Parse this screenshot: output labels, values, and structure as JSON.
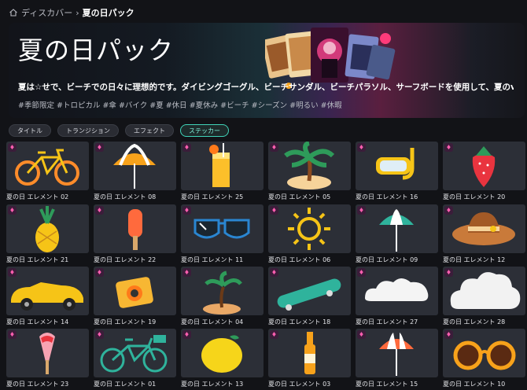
{
  "breadcrumb": {
    "home_label": "ディスカバー",
    "separator": "›",
    "current": "夏の日パック"
  },
  "hero": {
    "title": "夏の日パック",
    "description": "夏は☆せで、ビーチでの日々に理想的です。ダイビングゴーグル、ビーチサンダル、ビーチパラソル、サーフボードを使用して、夏のvlogを作...",
    "tags": "#季節限定 #トロピカル #傘 #バイク #夏 #休日 #夏休み #ビーチ #シーズン #明るい #休暇"
  },
  "tabs": [
    {
      "label": "タイトル",
      "active": false
    },
    {
      "label": "トランジション",
      "active": false
    },
    {
      "label": "エフェクト",
      "active": false
    },
    {
      "label": "ステッカー",
      "active": true
    }
  ],
  "stickers": [
    {
      "label": "夏の日 エレメント 02",
      "icon": "bicycle"
    },
    {
      "label": "夏の日 エレメント 08",
      "icon": "beach-umbrella"
    },
    {
      "label": "夏の日 エレメント 25",
      "icon": "juice-glass"
    },
    {
      "label": "夏の日 エレメント 05",
      "icon": "palm-island"
    },
    {
      "label": "夏の日 エレメント 16",
      "icon": "snorkel-mask"
    },
    {
      "label": "夏の日 エレメント 20",
      "icon": "strawberry"
    },
    {
      "label": "夏の日 エレメント 21",
      "icon": "pineapple"
    },
    {
      "label": "夏の日 エレメント 22",
      "icon": "popsicle"
    },
    {
      "label": "夏の日 エレメント 11",
      "icon": "sunglasses"
    },
    {
      "label": "夏の日 エレメント 06",
      "icon": "sun"
    },
    {
      "label": "夏の日 エレメント 09",
      "icon": "teal-umbrella"
    },
    {
      "label": "夏の日 エレメント 12",
      "icon": "sun-hat"
    },
    {
      "label": "夏の日 エレメント 14",
      "icon": "convertible-car"
    },
    {
      "label": "夏の日 エレメント 19",
      "icon": "camera"
    },
    {
      "label": "夏の日 エレメント 04",
      "icon": "palm-island-small"
    },
    {
      "label": "夏の日 エレメント 18",
      "icon": "skateboard"
    },
    {
      "label": "夏の日 エレメント 27",
      "icon": "cloud"
    },
    {
      "label": "夏の日 エレメント 28",
      "icon": "cloud-big"
    },
    {
      "label": "夏の日 エレメント 23",
      "icon": "ice-cream-bar"
    },
    {
      "label": "夏の日 エレメント 01",
      "icon": "teal-bicycle"
    },
    {
      "label": "夏の日 エレメント 13",
      "icon": "lemon"
    },
    {
      "label": "夏の日 エレメント 03",
      "icon": "bottle"
    },
    {
      "label": "夏の日 エレメント 15",
      "icon": "striped-umbrella"
    },
    {
      "label": "夏の日 エレメント 10",
      "icon": "orange-sunglasses"
    }
  ],
  "colors": {
    "accent": "#3fd3b8",
    "premium": "#ff5fb0",
    "card": "#2c2f37",
    "background": "#121317"
  }
}
